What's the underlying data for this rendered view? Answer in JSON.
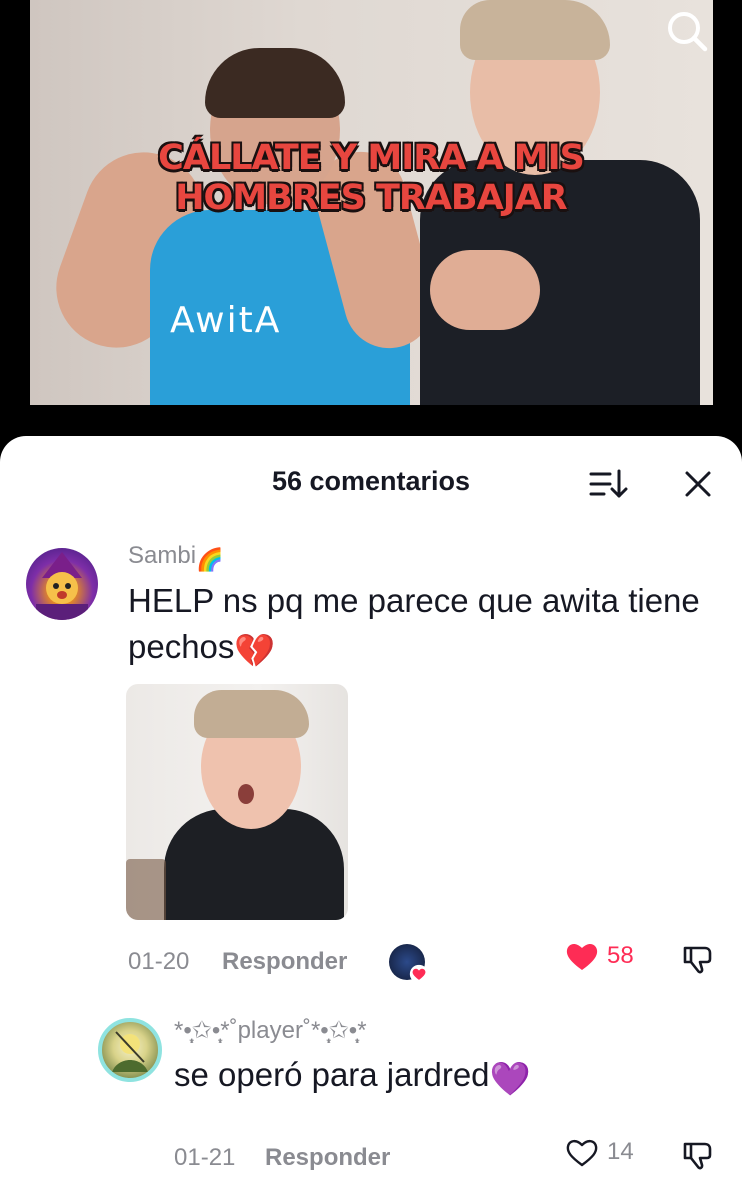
{
  "video": {
    "caption_line1": "CÁLLATE Y MIRA A MIS",
    "caption_line2": "HOMBRES TRABAJAR",
    "shirt_text": "AwitA"
  },
  "sheet": {
    "title": "56 comentarios"
  },
  "comments": [
    {
      "username": "Sambi",
      "username_emoji": "🌈",
      "text": "HELP ns pq me parece que awita tiene pechos",
      "text_emoji": "💔",
      "date": "01-20",
      "reply_label": "Responder",
      "likes": "58",
      "liked": true
    },
    {
      "username": "*•̩̩͙✩•̩̩͙*˚player˚*•̩̩͙✩•̩̩͙*",
      "text": "se operó para jardred",
      "text_emoji": "💜",
      "date": "01-21",
      "reply_label": "Responder",
      "likes": "14",
      "liked": false
    }
  ],
  "colors": {
    "like_red": "#fe2c55",
    "text_dark": "#161823",
    "text_muted": "#8a8b91",
    "caption_red": "#e8463f"
  },
  "icons": [
    "search-icon",
    "sort-icon",
    "close-icon",
    "heart-icon",
    "dislike-icon"
  ]
}
